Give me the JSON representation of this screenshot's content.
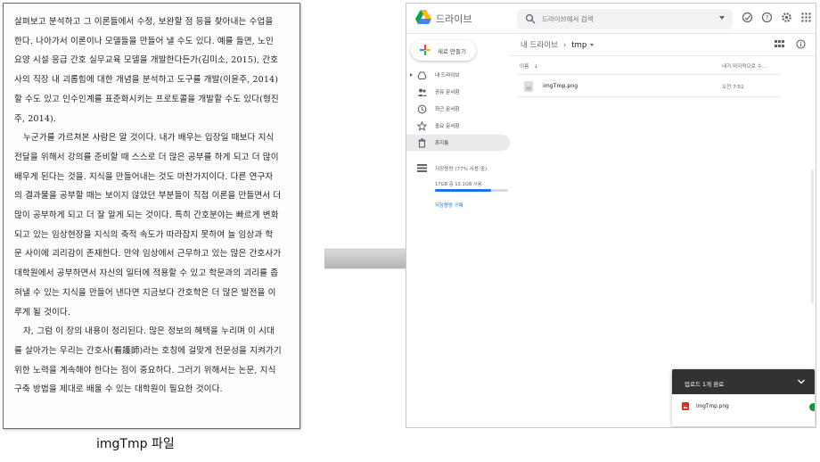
{
  "document": {
    "paragraphs": [
      {
        "lines": [
          "살펴보고 분석하고 그 이론들에서 수정, 보완할 점 등을 찾아내는 수업을",
          "한다. 나아가서 이론이나 모델들을 만들어 낼 수도 있다. 예를 들면, 노인",
          "요양 시설 응급 간호 실무교육 모델을 개발한다든가(김미소, 2015), 간호",
          "사의 직장 내 괴롭힘에 대한 개념을 분석하고 도구를 개발(이윤주, 2014)",
          "할 수도 있고 인수인계를 표준화시키는 프로토콜을 개발할 수도 있다(형진",
          "주, 2014)."
        ]
      },
      {
        "lines": [
          "누군가를 가르쳐본 사람은 알 것이다. 내가 배우는 입장일 때보다 지식",
          "전달을 위해서 강의를 준비할 때 스스로 더 많은 공부를 하게 되고 더 많이",
          "배우게 된다는 것을. 지식을 만들어내는 것도 마찬가지이다. 다른 연구자",
          "의 결과물을 공부할 때는 보이지 않았던 부분들이 직접 이론을 만들면서 더",
          "많이 공부하게 되고 더 잘 알게 되는 것이다. 특히 간호분야는 빠르게 변화",
          "되고 있는 임상현장을 지식의 축적 속도가 따라잡지 못하여 늘 임상과 학",
          "문 사이에 괴리감이 존재한다. 만약 임상에서 근무하고 있는 많은 간호사가",
          "대학원에서 공부하면서 자신의 일터에 적용할 수 있고 학문과의 괴리를 좁",
          "혀낼 수 있는 지식을 만들어 낸다면 지금보다 간호학은 더 많은 발전을 이",
          "루게 될 것이다."
        ]
      },
      {
        "lines": [
          "자, 그럼 이 장의 내용이 정리된다. 많은 정보의 혜택을 누리며 이 시대",
          "를 살아가는 우리는 간호사(看護師)라는 호칭에 걸맞게 전문성을 지켜가기",
          "위한 노력을 계속해야 한다는 점이 중요하다. 그러기 위해서는 논문, 지식",
          "구축 방법을 제대로 배울 수 있는 대학원이 필요한 것이다."
        ]
      }
    ],
    "caption": "imgTmp 파일"
  },
  "drive": {
    "brand": "드라이브",
    "search_placeholder": "드라이브에서 검색",
    "new_button": "새로 만들기",
    "nav": [
      {
        "label": "내 드라이브",
        "icon": "drive-icon"
      },
      {
        "label": "공유 문서함",
        "icon": "shared-icon"
      },
      {
        "label": "최근 문서함",
        "icon": "recent-icon"
      },
      {
        "label": "중요 문서함",
        "icon": "star-icon"
      },
      {
        "label": "휴지통",
        "icon": "trash-icon"
      }
    ],
    "storage": {
      "label": "저장용량 (77% 사용 중)",
      "usage": "17GB 중 13.1GB 사용",
      "used_fraction": 0.77,
      "buy_link": "저장용량 구매"
    },
    "breadcrumb": {
      "root": "내 드라이브",
      "current": "tmp"
    },
    "list": {
      "col_name": "이름",
      "col_modified": "내가 마지막으로 수...",
      "files": [
        {
          "name": "imgTmp.png",
          "modified": "오전 7:52"
        }
      ]
    },
    "upload": {
      "title": "업로드 1개 완료",
      "file": "imgTmp.png"
    },
    "colors": {
      "accent": "#1a73e8",
      "active_nav": "#e8eaed",
      "upload_header": "#323232",
      "image_file": "#d93025"
    }
  }
}
